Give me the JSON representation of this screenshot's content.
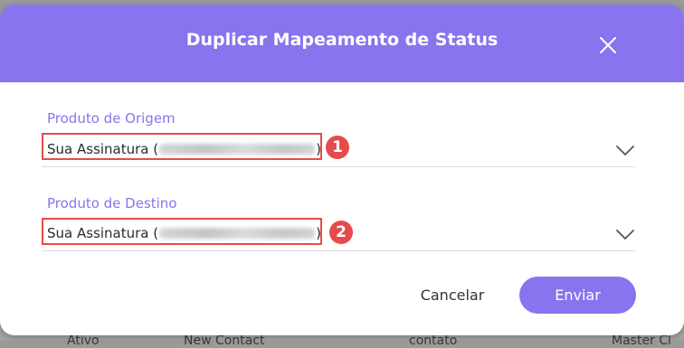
{
  "colors": {
    "accent": "#8a73ee",
    "highlight": "#e64b4b"
  },
  "background_table": {
    "cells": [
      "Ativo",
      "New Contact",
      "contato",
      "Master Cl"
    ]
  },
  "modal": {
    "title": "Duplicar Mapeamento de Status",
    "close_icon": "close-icon",
    "origin": {
      "label": "Produto de Origem",
      "value_prefix": "Sua Assinatura (",
      "value_suffix": ")",
      "marker": "1",
      "chevron_icon": "chevron-down-icon"
    },
    "destination": {
      "label": "Produto de Destino",
      "value_prefix": "Sua Assinatura (",
      "value_suffix": ")",
      "marker": "2",
      "chevron_icon": "chevron-down-icon"
    },
    "cancel_label": "Cancelar",
    "send_label": "Enviar"
  }
}
